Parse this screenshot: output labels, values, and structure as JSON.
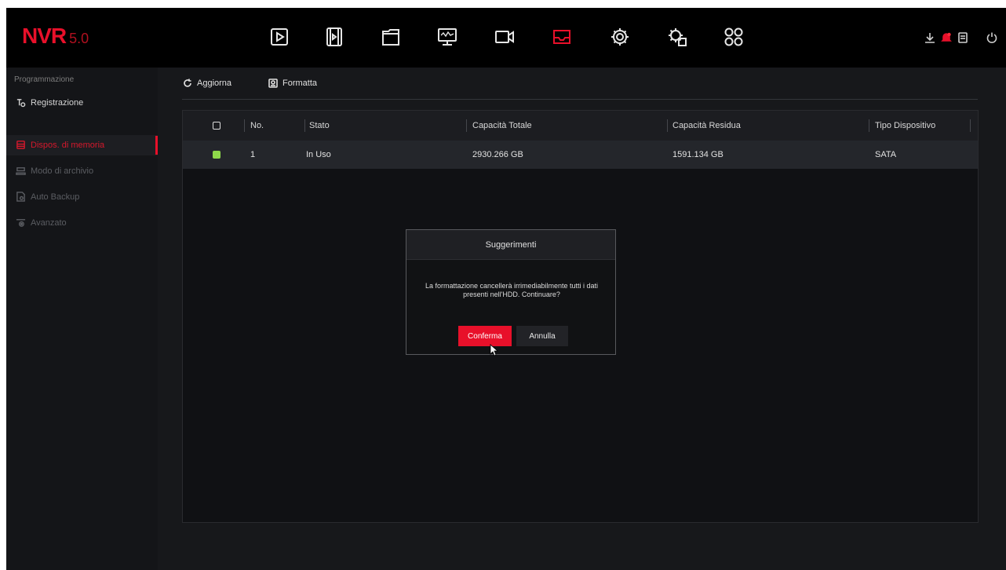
{
  "logo": {
    "brand": "NVR",
    "version": "5.0"
  },
  "colors": {
    "accent": "#e8102a",
    "status_in_use": "#8ed94a"
  },
  "topnav": {
    "icons": [
      "playback-icon",
      "video-clip-icon",
      "file-icon",
      "monitor-icon",
      "camera-icon",
      "storage-icon",
      "settings-icon",
      "system-settings-icon",
      "apps-icon"
    ],
    "active": "storage-icon"
  },
  "toolbar_right": {
    "icons": [
      "download-icon",
      "alarm-bell-icon",
      "info-icon",
      "power-icon"
    ]
  },
  "sidebar": {
    "section_title": "Programmazione",
    "record_label": "Registrazione",
    "items": [
      {
        "label": "Dispos. di memoria",
        "icon": "storage-device-icon",
        "active": true
      },
      {
        "label": "Modo di archivio",
        "icon": "archive-mode-icon",
        "active": false
      },
      {
        "label": "Auto Backup",
        "icon": "auto-backup-icon",
        "active": false
      },
      {
        "label": "Avanzato",
        "icon": "advanced-icon",
        "active": false
      }
    ]
  },
  "toolbar": {
    "refresh_label": "Aggiorna",
    "format_label": "Formatta"
  },
  "table": {
    "headers": {
      "no": "No.",
      "state": "Stato",
      "total": "Capacità Totale",
      "remaining": "Capacità Residua",
      "type": "Tipo Dispositivo"
    },
    "rows": [
      {
        "no": "1",
        "state": "In Uso",
        "total": "2930.266 GB",
        "remaining": "1591.134 GB",
        "type": "SATA"
      }
    ]
  },
  "dialog": {
    "title": "Suggerimenti",
    "message_line1": "La formattazione cancellerà irrimediabilmente tutti i dati",
    "message_line2": "presenti nell'HDD. Continuare?",
    "confirm_label": "Conferma",
    "cancel_label": "Annulla"
  }
}
